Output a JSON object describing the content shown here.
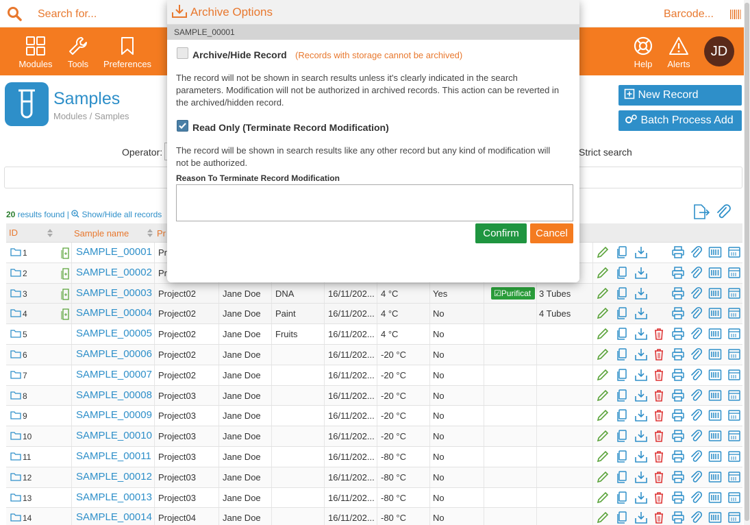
{
  "topbar": {
    "search_placeholder": "Search for...",
    "barcode_label": "Barcode..."
  },
  "nav": {
    "items": [
      {
        "label": "Modules",
        "icon": "grid-icon"
      },
      {
        "label": "Tools",
        "icon": "wrench-icon"
      },
      {
        "label": "Preferences",
        "icon": "bookmark-icon"
      },
      {
        "label": "Help",
        "icon": "lifebuoy-icon"
      },
      {
        "label": "Alerts",
        "icon": "warning-icon"
      }
    ],
    "avatar_initials": "JD"
  },
  "page": {
    "title": "Samples",
    "breadcrumb": "Modules / Samples",
    "new_record_label": "New Record",
    "batch_label": "Batch Process Add",
    "operator_label": "Operator:",
    "strict_label": "Strict search",
    "results_count": "20",
    "results_text": " results found",
    "show_hide_label": "Show/Hide all records"
  },
  "table": {
    "headers": {
      "id": "ID",
      "name": "Sample name",
      "project": "Pr"
    },
    "rows": [
      {
        "id": "1",
        "name": "SAMPLE_00001",
        "project": "Pr",
        "owner": "",
        "type": "",
        "date": "",
        "temp": "",
        "storage": "",
        "badge": "",
        "tubes": "",
        "doc": true,
        "trash": false
      },
      {
        "id": "2",
        "name": "SAMPLE_00002",
        "project": "Pr",
        "owner": "",
        "type": "",
        "date": "",
        "temp": "",
        "storage": "",
        "badge": "",
        "tubes": "",
        "doc": true,
        "trash": false
      },
      {
        "id": "3",
        "name": "SAMPLE_00003",
        "project": "Project02",
        "owner": "Jane Doe",
        "type": "DNA",
        "date": "16/11/202...",
        "temp": "4 °C",
        "storage": "Yes",
        "badge": "Purificat",
        "tubes": "3 Tubes",
        "doc": true,
        "trash": false
      },
      {
        "id": "4",
        "name": "SAMPLE_00004",
        "project": "Project02",
        "owner": "Jane Doe",
        "type": "Paint",
        "date": "16/11/202...",
        "temp": "4 °C",
        "storage": "No",
        "badge": "",
        "tubes": "4 Tubes",
        "doc": true,
        "trash": false
      },
      {
        "id": "5",
        "name": "SAMPLE_00005",
        "project": "Project02",
        "owner": "Jane Doe",
        "type": "Fruits",
        "date": "16/11/202...",
        "temp": "4 °C",
        "storage": "No",
        "badge": "",
        "tubes": "",
        "doc": false,
        "trash": true
      },
      {
        "id": "6",
        "name": "SAMPLE_00006",
        "project": "Project02",
        "owner": "Jane Doe",
        "type": "",
        "date": "16/11/202...",
        "temp": "-20 °C",
        "storage": "No",
        "badge": "",
        "tubes": "",
        "doc": false,
        "trash": true
      },
      {
        "id": "7",
        "name": "SAMPLE_00007",
        "project": "Project02",
        "owner": "Jane Doe",
        "type": "",
        "date": "16/11/202...",
        "temp": "-20 °C",
        "storage": "No",
        "badge": "",
        "tubes": "",
        "doc": false,
        "trash": true
      },
      {
        "id": "8",
        "name": "SAMPLE_00008",
        "project": "Project03",
        "owner": "Jane Doe",
        "type": "",
        "date": "16/11/202...",
        "temp": "-20 °C",
        "storage": "No",
        "badge": "",
        "tubes": "",
        "doc": false,
        "trash": true
      },
      {
        "id": "9",
        "name": "SAMPLE_00009",
        "project": "Project03",
        "owner": "Jane Doe",
        "type": "",
        "date": "16/11/202...",
        "temp": "-20 °C",
        "storage": "No",
        "badge": "",
        "tubes": "",
        "doc": false,
        "trash": true
      },
      {
        "id": "10",
        "name": "SAMPLE_00010",
        "project": "Project03",
        "owner": "Jane Doe",
        "type": "",
        "date": "16/11/202...",
        "temp": "-20 °C",
        "storage": "No",
        "badge": "",
        "tubes": "",
        "doc": false,
        "trash": true
      },
      {
        "id": "11",
        "name": "SAMPLE_00011",
        "project": "Project03",
        "owner": "Jane Doe",
        "type": "",
        "date": "16/11/202...",
        "temp": "-80 °C",
        "storage": "No",
        "badge": "",
        "tubes": "",
        "doc": false,
        "trash": true
      },
      {
        "id": "12",
        "name": "SAMPLE_00012",
        "project": "Project03",
        "owner": "Jane Doe",
        "type": "",
        "date": "16/11/202...",
        "temp": "-80 °C",
        "storage": "No",
        "badge": "",
        "tubes": "",
        "doc": false,
        "trash": true
      },
      {
        "id": "13",
        "name": "SAMPLE_00013",
        "project": "Project03",
        "owner": "Jane Doe",
        "type": "",
        "date": "16/11/202...",
        "temp": "-80 °C",
        "storage": "No",
        "badge": "",
        "tubes": "",
        "doc": false,
        "trash": true
      },
      {
        "id": "14",
        "name": "SAMPLE_00014",
        "project": "Project04",
        "owner": "Jane Doe",
        "type": "",
        "date": "16/11/202...",
        "temp": "-80 °C",
        "storage": "No",
        "badge": "",
        "tubes": "",
        "doc": false,
        "trash": true
      }
    ]
  },
  "modal": {
    "title": "Archive Options",
    "record": "SAMPLE_00001",
    "archive_label": "Archive/Hide Record",
    "archive_note": "(Records with storage cannot be archived)",
    "archive_desc": "The record will not be shown in search results unless it's clearly indicated in the search parameters. Modification will not be authorized in archived records. This action can be reverted in the archived/hidden record.",
    "archive_checked": false,
    "readonly_label": "Read Only (Terminate Record Modification)",
    "readonly_desc": "The record will be shown in search results like any other record but any kind of modification will not be authorized.",
    "readonly_checked": true,
    "reason_label": "Reason To Terminate Record Modification",
    "reason_value": "",
    "confirm_label": "Confirm",
    "cancel_label": "Cancel"
  },
  "colors": {
    "accent": "#f47b20",
    "link": "#2e8fc9",
    "confirm": "#1f9540",
    "badge": "#2a9d3a"
  }
}
